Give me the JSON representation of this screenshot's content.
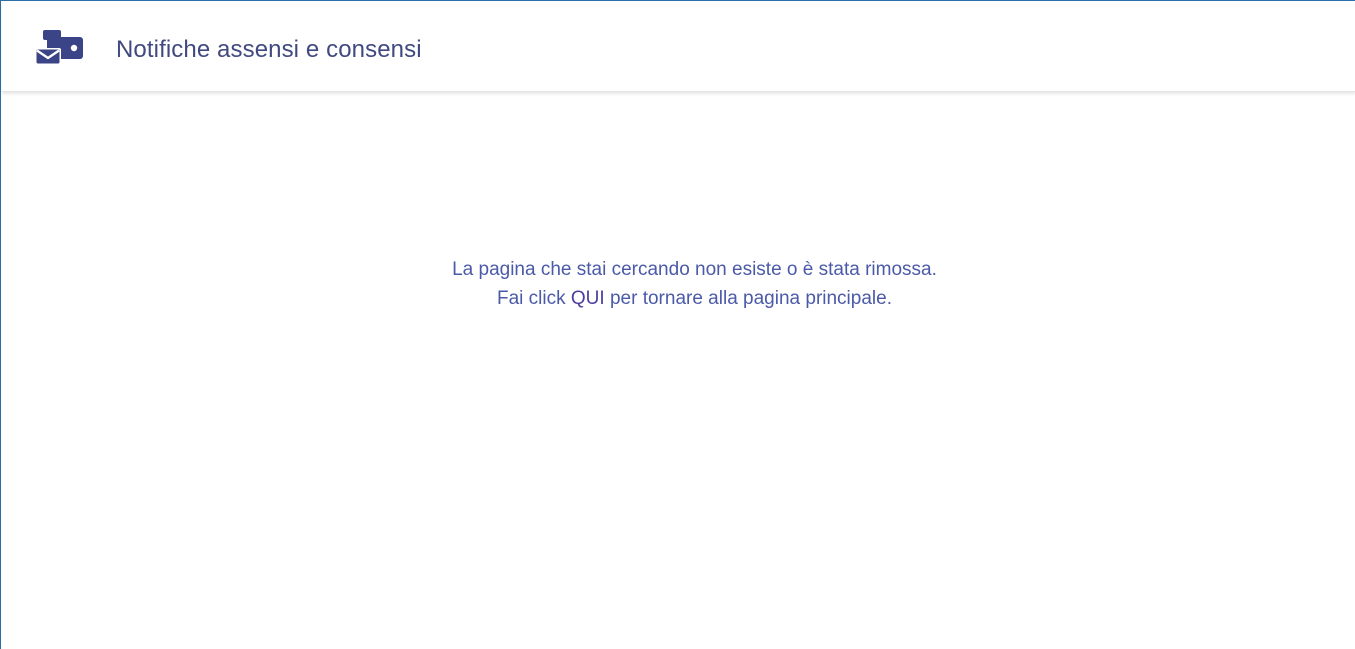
{
  "header": {
    "title": "Notifiche assensi e consensi",
    "icon": "notifications-envelope-icon"
  },
  "message": {
    "line1": "La pagina che stai cercando non esiste o è stata rimossa.",
    "line2_prefix": "Fai click ",
    "link_label": "QUI",
    "line2_suffix": " per tornare alla pagina principale."
  },
  "colors": {
    "brand": "#3a4486",
    "title_text": "#414a80",
    "message_text": "#4b5aa8",
    "frame_border": "#2c6ea6"
  }
}
